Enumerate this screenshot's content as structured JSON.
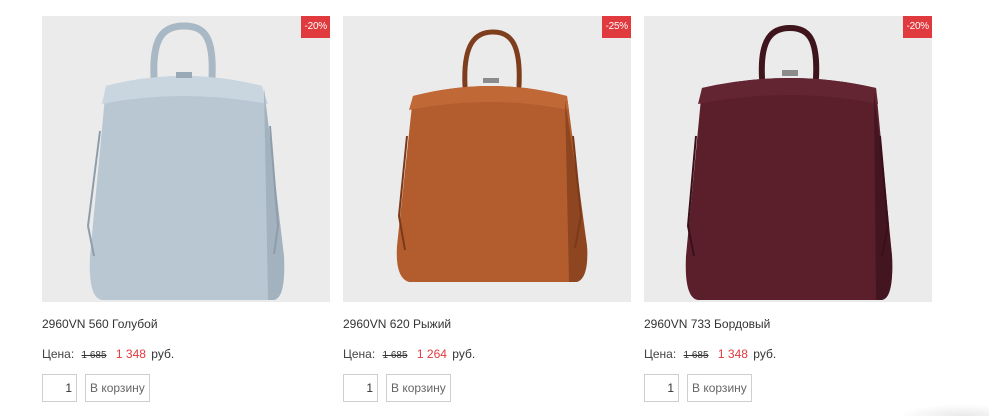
{
  "products": [
    {
      "discount": "-20%",
      "title": "2960VN 560 Голубой",
      "price_label": "Цена:",
      "old_price": "1 685",
      "new_price": "1 348",
      "currency": "руб.",
      "qty": "1",
      "cart_label": "В корзину",
      "color": "#b9c7d3",
      "shade": "#a3b2bf",
      "handle_color": "#aab9c6"
    },
    {
      "discount": "-25%",
      "title": "2960VN 620 Рыжий",
      "price_label": "Цена:",
      "old_price": "1 685",
      "new_price": "1 264",
      "currency": "руб.",
      "qty": "1",
      "cart_label": "В корзину",
      "color": "#b35d2e",
      "shade": "#8e4620",
      "handle_color": "#934b24"
    },
    {
      "discount": "-20%",
      "title": "2960VN 733 Бордовый",
      "price_label": "Цена:",
      "old_price": "1 685",
      "new_price": "1 348",
      "currency": "руб.",
      "qty": "1",
      "cart_label": "В корзину",
      "color": "#5a1f2a",
      "shade": "#431520",
      "handle_color": "#3e141d"
    }
  ]
}
